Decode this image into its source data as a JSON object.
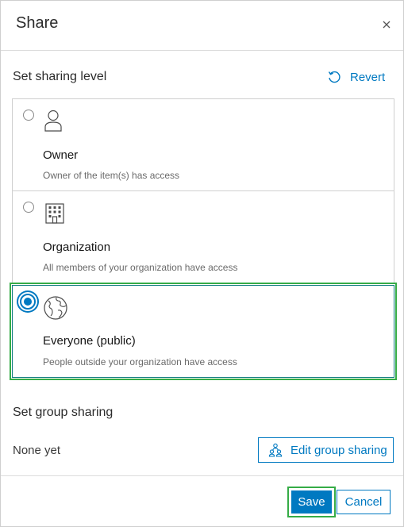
{
  "dialog": {
    "title": "Share",
    "close_icon": "close-icon"
  },
  "sharing_level": {
    "label": "Set sharing level",
    "revert_label": "Revert",
    "revert_icon": "undo-icon",
    "options": [
      {
        "title": "Owner",
        "description": "Owner of the item(s) has access",
        "icon": "user-icon",
        "selected": false
      },
      {
        "title": "Organization",
        "description": "All members of your organization have access",
        "icon": "building-icon",
        "selected": false
      },
      {
        "title": "Everyone (public)",
        "description": "People outside your organization have access",
        "icon": "globe-icon",
        "selected": true
      }
    ]
  },
  "group_sharing": {
    "label": "Set group sharing",
    "status": "None yet",
    "edit_label": "Edit group sharing",
    "edit_icon": "group-icon"
  },
  "footer": {
    "save_label": "Save",
    "cancel_label": "Cancel"
  },
  "colors": {
    "accent": "#0079c1",
    "highlight": "#35ac46"
  }
}
